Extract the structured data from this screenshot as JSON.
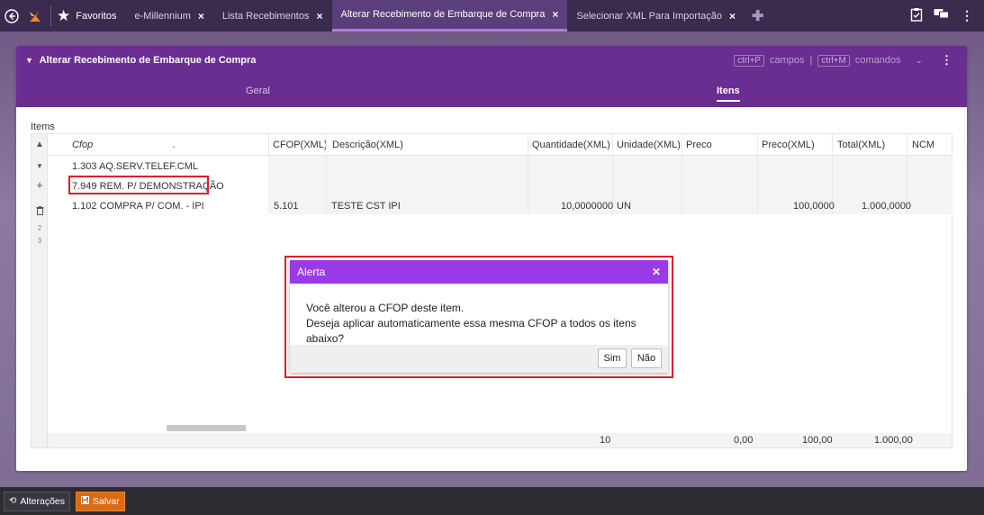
{
  "topbar": {
    "tabs": [
      {
        "label": "Favoritos"
      },
      {
        "label": "e-Millennium"
      },
      {
        "label": "Lista Recebimentos"
      },
      {
        "label": "Alterar Recebimento de Embarque de Compra"
      },
      {
        "label": "Selecionar XML Para Importação"
      }
    ],
    "close_glyph": "×",
    "icons": [
      "back-icon",
      "logo-icon",
      "star-icon",
      "plus-icon",
      "clipboard-icon",
      "chat-icon",
      "more-vert-icon"
    ]
  },
  "panel": {
    "title": "Alterar Recebimento de Embarque de Compra",
    "shortcuts": {
      "fields_key": "ctrl+P",
      "fields_label": "campos",
      "separator": "|",
      "commands_key": "ctrl+M",
      "commands_label": "comandos"
    },
    "subtabs": {
      "geral": "Geral",
      "itens": "Itens"
    }
  },
  "grid": {
    "label": "Items",
    "columns": [
      "Cfop",
      "CFOP(XML)",
      "Descrição(XML)",
      "Quantidade(XML)",
      "Unidade(XML)",
      "Preco",
      "Preco(XML)",
      "Total(XML)",
      "NCM"
    ],
    "rows": [
      {
        "cfop": "1.303 AQ.SERV.TELEF.CML",
        "cfop_xml": "",
        "descricao": "",
        "quantidade": "",
        "unidade": "",
        "preco": "",
        "preco_xml": "",
        "total": ""
      },
      {
        "cfop": "7.949 REM. P/ DEMONSTRAÇÃO",
        "cfop_xml": "",
        "descricao": "",
        "quantidade": "",
        "unidade": "",
        "preco": "",
        "preco_xml": "",
        "total": ""
      },
      {
        "cfop": "1.102 COMPRA P/ COM. - IPI",
        "cfop_xml": "5.101",
        "descricao": "TESTE CST IPI",
        "quantidade": "10,0000000",
        "unidade": "UN",
        "preco": "",
        "preco_xml": "100,0000",
        "total": "1.000,0000"
      }
    ],
    "side_numbers": [
      "2",
      "3"
    ],
    "footer": {
      "quantidade": "10",
      "preco": "0,00",
      "preco_xml": "100,00",
      "total": "1.000,00"
    }
  },
  "dialog": {
    "title": "Alerta",
    "line1": "Você alterou a CFOP deste item.",
    "line2": "Deseja aplicar automaticamente essa mesma CFOP a todos os itens abaixo?",
    "yes": "Sim",
    "no": "Não"
  },
  "bottombar": {
    "changes": "Alterações",
    "save": "Salvar"
  },
  "colors": {
    "accent": "#6a2d91",
    "dialog_header": "#9a3ae6",
    "highlight": "#e01e2b",
    "save": "#d96b14"
  }
}
